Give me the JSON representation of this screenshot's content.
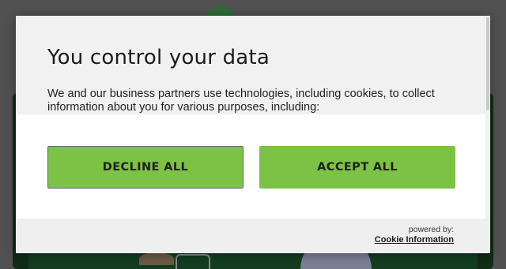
{
  "consent_dialog": {
    "title": "You control your data",
    "body_text": "We and our business partners use technologies, including cookies, to collect information about you for various purposes, including:",
    "decline_label": "DECLINE ALL",
    "accept_label": "ACCEPT ALL",
    "powered_by_label": "powered by:",
    "provider_name": "Cookie Information"
  },
  "colors": {
    "button_green": "#7cc245",
    "overlay": "#4a4b4a",
    "dialog_bg": "#f1f1f1"
  }
}
